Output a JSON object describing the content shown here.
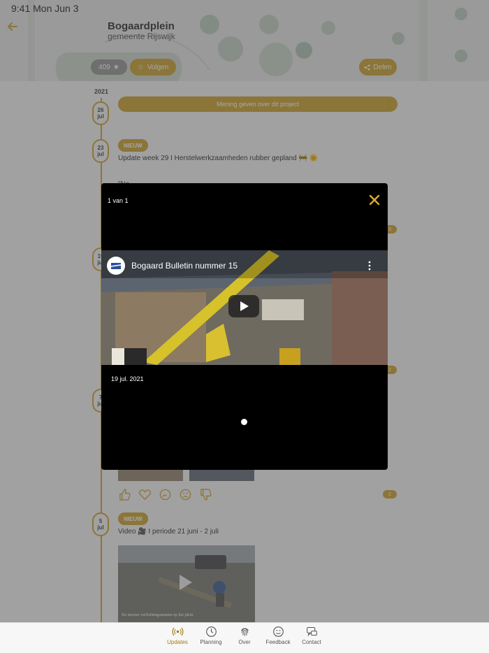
{
  "status_bar": {
    "time": "9:41  Mon Jun 3"
  },
  "header": {
    "title": "Bogaardplein",
    "subtitle": "gemeente Rijswijk",
    "follower_count": "409",
    "follow_label": "Volgen",
    "share_label": "Delen"
  },
  "timeline": {
    "year": "2021",
    "opinion_button": "Mening geven over dit project",
    "dates": [
      {
        "day": "26",
        "month": "jul"
      },
      {
        "day": "23",
        "month": "jul"
      },
      {
        "day": "19",
        "month": "jul"
      },
      {
        "day": "7",
        "month": "jul"
      },
      {
        "day": "5",
        "month": "jul"
      }
    ],
    "posts": [
      {
        "badge": "NIEUW",
        "title": "Update week 29 I Herstelwerkzaamheden rubber gepland 🚧 🌞",
        "text": "\"Na..."
      },
      {
        "badge": "NIEUW",
        "title": "Video 🎥  I periode 21 juni - 2 juli",
        "video_caption": "De nieuwe verlichtingsmasten op het plein"
      }
    ],
    "reaction_count": "2",
    "pill_count_1": "3",
    "pill_count_2": "2"
  },
  "modal": {
    "counter": "1 van 1",
    "video_title": "Bogaard Bulletin nummer 15",
    "date": "19 jul. 2021"
  },
  "tabs": [
    {
      "label": "Updates",
      "icon": "broadcast-icon",
      "active": true
    },
    {
      "label": "Planning",
      "icon": "clock-icon",
      "active": false
    },
    {
      "label": "Over",
      "icon": "fingerprint-icon",
      "active": false
    },
    {
      "label": "Feedback",
      "icon": "smiley-icon",
      "active": false
    },
    {
      "label": "Contact",
      "icon": "chat-icon",
      "active": false
    }
  ],
  "colors": {
    "accent": "#c79a20",
    "modal_bg": "#000000"
  }
}
